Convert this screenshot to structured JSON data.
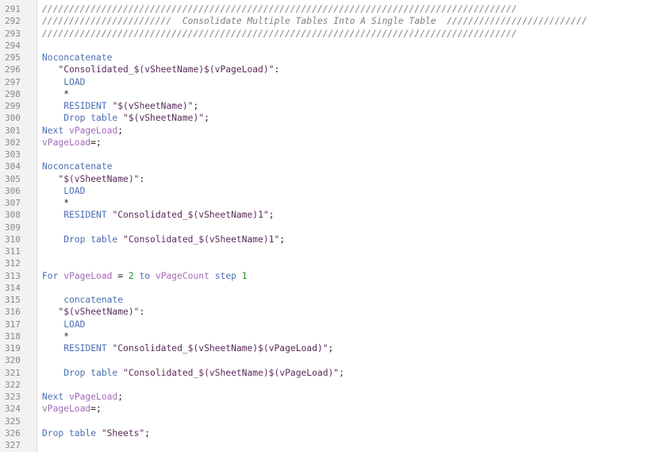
{
  "colors": {
    "gutter_bg": "#f2f2f2",
    "line_number": "#888888",
    "comment": "#7f7f7f",
    "keyword": "#4a6fb5",
    "variable": "#a56ab8",
    "string": "#5a2a5a",
    "number": "#2e8b2e",
    "text": "#222222"
  },
  "editor": {
    "lines": [
      {
        "num": "291",
        "tokens": [
          {
            "t": "comment",
            "text": "////////////////////////////////////////////////////////////////////////////////////////"
          }
        ]
      },
      {
        "num": "292",
        "tokens": [
          {
            "t": "comment",
            "text": "////////////////////////  Consolidate Multiple Tables Into A Single Table  //////////////////////////"
          }
        ]
      },
      {
        "num": "293",
        "tokens": [
          {
            "t": "comment",
            "text": "////////////////////////////////////////////////////////////////////////////////////////"
          }
        ]
      },
      {
        "num": "294",
        "tokens": []
      },
      {
        "num": "295",
        "tokens": [
          {
            "t": "kw",
            "text": "Noconcatenate"
          }
        ]
      },
      {
        "num": "296",
        "tokens": [
          {
            "t": "plain",
            "text": "   "
          },
          {
            "t": "str",
            "text": "\"Consolidated_$(vSheetName)$(vPageLoad)\""
          },
          {
            "t": "punct",
            "text": ":"
          }
        ]
      },
      {
        "num": "297",
        "tokens": [
          {
            "t": "plain",
            "text": "    "
          },
          {
            "t": "kw",
            "text": "LOAD"
          }
        ]
      },
      {
        "num": "298",
        "tokens": [
          {
            "t": "plain",
            "text": "    *"
          }
        ]
      },
      {
        "num": "299",
        "tokens": [
          {
            "t": "plain",
            "text": "    "
          },
          {
            "t": "kw",
            "text": "RESIDENT"
          },
          {
            "t": "plain",
            "text": " "
          },
          {
            "t": "str",
            "text": "\"$(vSheetName)\""
          },
          {
            "t": "punct",
            "text": ";"
          }
        ]
      },
      {
        "num": "300",
        "tokens": [
          {
            "t": "plain",
            "text": "    "
          },
          {
            "t": "kw",
            "text": "Drop table"
          },
          {
            "t": "plain",
            "text": " "
          },
          {
            "t": "str",
            "text": "\"$(vSheetName)\""
          },
          {
            "t": "punct",
            "text": ";"
          }
        ]
      },
      {
        "num": "301",
        "tokens": [
          {
            "t": "kw",
            "text": "Next"
          },
          {
            "t": "plain",
            "text": " "
          },
          {
            "t": "var",
            "text": "vPageLoad"
          },
          {
            "t": "punct",
            "text": ";"
          }
        ]
      },
      {
        "num": "302",
        "tokens": [
          {
            "t": "var",
            "text": "vPageLoad"
          },
          {
            "t": "punct",
            "text": "=;"
          }
        ]
      },
      {
        "num": "303",
        "tokens": []
      },
      {
        "num": "304",
        "tokens": [
          {
            "t": "kw",
            "text": "Noconcatenate"
          }
        ]
      },
      {
        "num": "305",
        "tokens": [
          {
            "t": "plain",
            "text": "   "
          },
          {
            "t": "str",
            "text": "\"$(vSheetName)\""
          },
          {
            "t": "punct",
            "text": ":"
          }
        ]
      },
      {
        "num": "306",
        "tokens": [
          {
            "t": "plain",
            "text": "    "
          },
          {
            "t": "kw",
            "text": "LOAD"
          }
        ]
      },
      {
        "num": "307",
        "tokens": [
          {
            "t": "plain",
            "text": "    *"
          }
        ]
      },
      {
        "num": "308",
        "tokens": [
          {
            "t": "plain",
            "text": "    "
          },
          {
            "t": "kw",
            "text": "RESIDENT"
          },
          {
            "t": "plain",
            "text": " "
          },
          {
            "t": "str",
            "text": "\"Consolidated_$(vSheetName)1\""
          },
          {
            "t": "punct",
            "text": ";"
          }
        ]
      },
      {
        "num": "309",
        "tokens": []
      },
      {
        "num": "310",
        "tokens": [
          {
            "t": "plain",
            "text": "    "
          },
          {
            "t": "kw",
            "text": "Drop table"
          },
          {
            "t": "plain",
            "text": " "
          },
          {
            "t": "str",
            "text": "\"Consolidated_$(vSheetName)1\""
          },
          {
            "t": "punct",
            "text": ";"
          }
        ]
      },
      {
        "num": "311",
        "tokens": []
      },
      {
        "num": "312",
        "tokens": []
      },
      {
        "num": "313",
        "tokens": [
          {
            "t": "kw",
            "text": "For"
          },
          {
            "t": "plain",
            "text": " "
          },
          {
            "t": "var",
            "text": "vPageLoad"
          },
          {
            "t": "plain",
            "text": " = "
          },
          {
            "t": "num",
            "text": "2"
          },
          {
            "t": "plain",
            "text": " "
          },
          {
            "t": "kw",
            "text": "to"
          },
          {
            "t": "plain",
            "text": " "
          },
          {
            "t": "var",
            "text": "vPageCount"
          },
          {
            "t": "plain",
            "text": " "
          },
          {
            "t": "kw",
            "text": "step"
          },
          {
            "t": "plain",
            "text": " "
          },
          {
            "t": "num",
            "text": "1"
          }
        ]
      },
      {
        "num": "314",
        "tokens": []
      },
      {
        "num": "315",
        "tokens": [
          {
            "t": "plain",
            "text": "    "
          },
          {
            "t": "kw",
            "text": "concatenate"
          }
        ]
      },
      {
        "num": "316",
        "tokens": [
          {
            "t": "plain",
            "text": "   "
          },
          {
            "t": "str",
            "text": "\"$(vSheetName)\""
          },
          {
            "t": "punct",
            "text": ":"
          }
        ]
      },
      {
        "num": "317",
        "tokens": [
          {
            "t": "plain",
            "text": "    "
          },
          {
            "t": "kw",
            "text": "LOAD"
          }
        ]
      },
      {
        "num": "318",
        "tokens": [
          {
            "t": "plain",
            "text": "    *"
          }
        ]
      },
      {
        "num": "319",
        "tokens": [
          {
            "t": "plain",
            "text": "    "
          },
          {
            "t": "kw",
            "text": "RESIDENT"
          },
          {
            "t": "plain",
            "text": " "
          },
          {
            "t": "str",
            "text": "\"Consolidated_$(vSheetName)$(vPageLoad)\""
          },
          {
            "t": "punct",
            "text": ";"
          }
        ]
      },
      {
        "num": "320",
        "tokens": []
      },
      {
        "num": "321",
        "tokens": [
          {
            "t": "plain",
            "text": "    "
          },
          {
            "t": "kw",
            "text": "Drop table"
          },
          {
            "t": "plain",
            "text": " "
          },
          {
            "t": "str",
            "text": "\"Consolidated_$(vSheetName)$(vPageLoad)\""
          },
          {
            "t": "punct",
            "text": ";"
          }
        ]
      },
      {
        "num": "322",
        "tokens": []
      },
      {
        "num": "323",
        "tokens": [
          {
            "t": "kw",
            "text": "Next"
          },
          {
            "t": "plain",
            "text": " "
          },
          {
            "t": "var",
            "text": "vPageLoad"
          },
          {
            "t": "punct",
            "text": ";"
          }
        ]
      },
      {
        "num": "324",
        "tokens": [
          {
            "t": "var",
            "text": "vPageLoad"
          },
          {
            "t": "punct",
            "text": "=;"
          }
        ]
      },
      {
        "num": "325",
        "tokens": []
      },
      {
        "num": "326",
        "tokens": [
          {
            "t": "kw",
            "text": "Drop table"
          },
          {
            "t": "plain",
            "text": " "
          },
          {
            "t": "str",
            "text": "\"Sheets\""
          },
          {
            "t": "punct",
            "text": ";"
          }
        ]
      },
      {
        "num": "327",
        "tokens": []
      }
    ]
  }
}
